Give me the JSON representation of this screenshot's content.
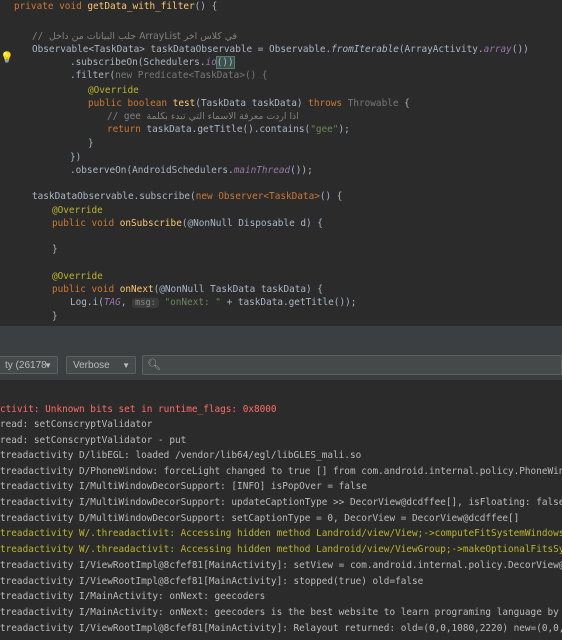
{
  "editor": {
    "lines": {
      "l0_a": "private void",
      "l0_b": "getData_with_filter",
      "l0_c": "() {",
      "l1_cm": "// ",
      "l1_ar": "جلب البيانات من داخل ArrayList في كلاس اخر",
      "l2_a": "Observable<TaskData> taskDataObservable = Observable.",
      "l2_b": "fromIterable",
      "l2_c": "(ArrayActivity.",
      "l2_d": "array",
      "l2_e": "())",
      "l3_a": ".subscribeOn(Schedulers.",
      "l3_b": "io",
      "l3_c": "())",
      "l4_a": ".filter(",
      "l4_b": "new Predicate<TaskData>",
      "l4_c": "() {",
      "l5": "@Override",
      "l6_a": "public boolean",
      "l6_b": "test",
      "l6_c": "(TaskData taskData)",
      "l6_d": "throws",
      "l6_e": "Throwable",
      "l6_f": " {",
      "l7_cm": "// gee ",
      "l7_ar": "اذا اردت معرفة الاسماء التي تبدء بكلمة",
      "l8_a": "return",
      "l8_b": " taskData.getTitle().contains(",
      "l8_c": "\"gee\"",
      "l8_d": ");",
      "l9": "}",
      "l10": "})",
      "l11_a": ".observeOn(AndroidSchedulers.",
      "l11_b": "mainThread",
      "l11_c": "());",
      "l12_a": "taskDataObservable.subscribe(",
      "l12_b": "new Observer<TaskData>",
      "l12_c": "() {",
      "l13": "@Override",
      "l14_a": "public void",
      "l14_b": "onSubscribe",
      "l14_c": "(@NonNull Disposable d) {",
      "l15": "}",
      "l16": "@Override",
      "l17_a": "public void",
      "l17_b": "onNext",
      "l17_c": "(@NonNull TaskData taskData) {",
      "l18_a": "Log.i(",
      "l18_b": "TAG",
      "l18_c": ", ",
      "l18_hint": "msg:",
      "l18_d": "\"onNext: \"",
      "l18_e": " + taskData.getTitle());",
      "l19": "}"
    }
  },
  "logcat": {
    "process_select": "ty (26178",
    "level_select": "Verbose",
    "search_placeholder": "",
    "lines": [
      "ctivit: Unknown bits set in runtime_flags: 0x8000",
      "read: setConscryptValidator",
      "read: setConscryptValidator - put",
      "treadactivity D/libEGL: loaded /vendor/lib64/egl/libGLES_mali.so",
      "treadactivity D/PhoneWindow: forceLight changed to true [] from com.android.internal.policy.PhoneWindow.",
      "treadactivity I/MultiWindowDecorSupport: [INFO] isPopOver = false",
      "treadactivity I/MultiWindowDecorSupport: updateCaptionType >> DecorView@dcdffee[], isFloating: false, is",
      "treadactivity D/MultiWindowDecorSupport: setCaptionType = 0, DecorView = DecorView@dcdffee[]",
      "treadactivity W/.threadactivit: Accessing hidden method Landroid/view/View;->computeFitSystemWindows(Lan",
      "treadactivity W/.threadactivit: Accessing hidden method Landroid/view/ViewGroup;->makeOptionalFitsSystem",
      "treadactivity I/ViewRootImpl@8cfef81[MainActivity]: setView = com.android.internal.policy.DecorView@dcdf",
      "treadactivity I/ViewRootImpl@8cfef81[MainActivity]: stopped(true) old=false",
      "treadactivity I/MainActivity: onNext: geecoders",
      "treadactivity I/MainActivity: onNext: geecoders is the best website to learn programing language by simp",
      "treadactivity I/ViewRootImpl@8cfef81[MainActivity]: Relayout returned: old=(0,0,1080,2220) new=(0,0,1080"
    ],
    "line_levels": [
      "err",
      "dbg",
      "dbg",
      "dbg",
      "dbg",
      "info",
      "info",
      "dbg",
      "warn",
      "warn",
      "info",
      "info",
      "info",
      "info",
      "info"
    ]
  },
  "colors": {
    "editor_bg": "#2b2b2b",
    "keyword": "#cc7832",
    "error": "#ff6b68",
    "warning": "#bbb529"
  },
  "icons": {
    "bulb": "lightbulb-icon",
    "search": "search-icon",
    "dropdown": "chevron-down-icon"
  }
}
